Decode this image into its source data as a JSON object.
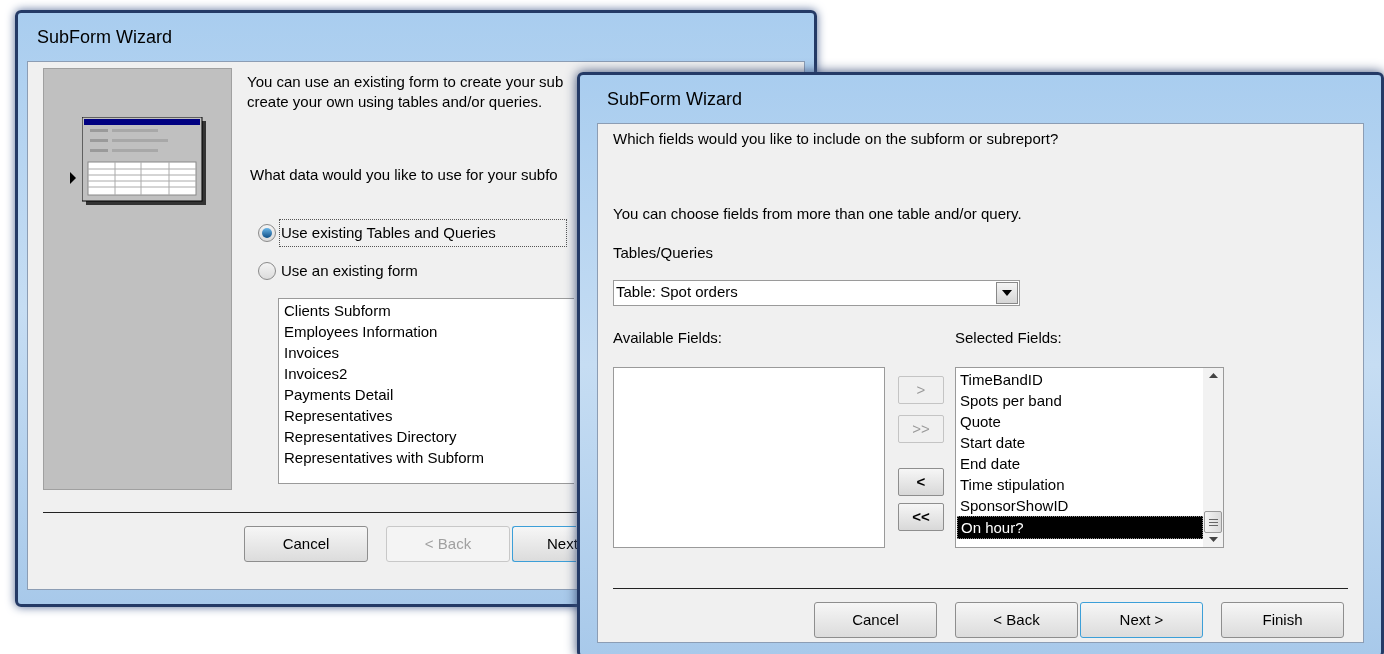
{
  "windows": [
    {
      "title": "SubForm Wizard",
      "intro_lines": [
        "You can use an existing form to create your sub",
        "create your own using tables and/or queries."
      ],
      "question": "What data would you like to use for your subfo",
      "options": [
        {
          "label": "Use existing Tables and Queries",
          "selected": true,
          "focused": true
        },
        {
          "label": "Use an existing form",
          "selected": false,
          "focused": false
        }
      ],
      "forms_list": [
        "Clients Subform",
        "Employees Information",
        "Invoices",
        "Invoices2",
        "Payments Detail",
        "Representatives",
        "Representatives Directory",
        "Representatives with Subform"
      ],
      "buttons": [
        {
          "label": "Cancel",
          "disabled": false,
          "focused": false
        },
        {
          "label": "< Back",
          "disabled": true,
          "focused": false
        },
        {
          "label": "Next",
          "disabled": false,
          "focused": true
        }
      ]
    },
    {
      "title": "SubForm Wizard",
      "question": "Which fields would you like to include on the subform or subreport?",
      "hint": "You can choose fields from more than one table and/or query.",
      "combo": {
        "label": "Tables/Queries",
        "value": "Table: Spot orders"
      },
      "available_label": "Available Fields:",
      "selected_label": "Selected Fields:",
      "move_buttons": [
        {
          "label": ">",
          "disabled": true
        },
        {
          "label": ">>",
          "disabled": true
        },
        {
          "label": "<",
          "disabled": false
        },
        {
          "label": "<<",
          "disabled": false
        }
      ],
      "selected_fields": [
        {
          "label": "TimeBandID",
          "selected": false
        },
        {
          "label": "Spots per band",
          "selected": false
        },
        {
          "label": "Quote",
          "selected": false
        },
        {
          "label": "Start date",
          "selected": false
        },
        {
          "label": "End date",
          "selected": false
        },
        {
          "label": "Time stipulation",
          "selected": false
        },
        {
          "label": "SponsorShowID",
          "selected": false
        },
        {
          "label": "On hour?",
          "selected": true
        }
      ],
      "buttons": [
        {
          "label": "Cancel",
          "disabled": false,
          "focused": false
        },
        {
          "label": "< Back",
          "disabled": false,
          "focused": false
        },
        {
          "label": "Next >",
          "disabled": false,
          "focused": true
        },
        {
          "label": "Finish",
          "disabled": false,
          "focused": false
        }
      ]
    }
  ]
}
